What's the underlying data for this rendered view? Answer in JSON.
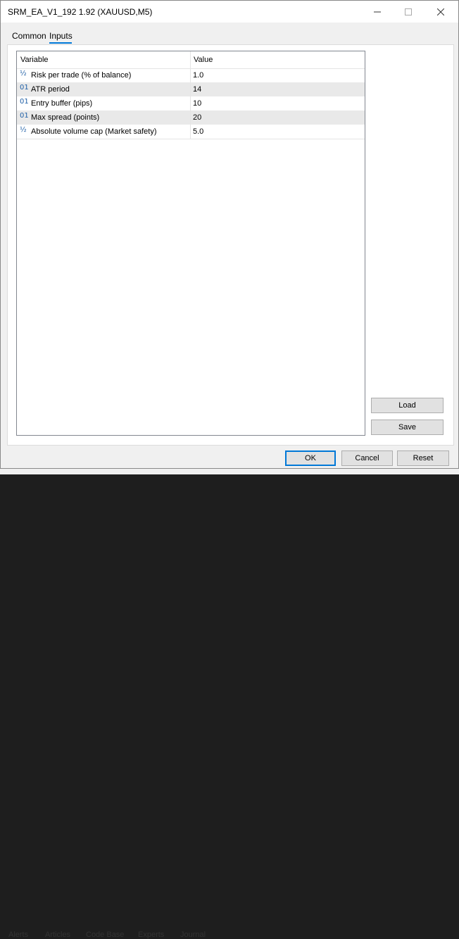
{
  "window": {
    "title": "SRM_EA_V1_192 1.92 (XAUUSD,M5)"
  },
  "tabs": [
    {
      "label": "Common"
    },
    {
      "label": "Inputs"
    }
  ],
  "table": {
    "headers": {
      "variable": "Variable",
      "value": "Value"
    },
    "rows": [
      {
        "icon": "fraction-icon",
        "glyph": "½",
        "name": "Risk per trade (% of balance)",
        "value": "1.0"
      },
      {
        "icon": "integer-icon",
        "glyph": "01",
        "name": "ATR period",
        "value": "14"
      },
      {
        "icon": "integer-icon",
        "glyph": "01",
        "name": "Entry buffer (pips)",
        "value": "10"
      },
      {
        "icon": "integer-icon",
        "glyph": "01",
        "name": "Max spread (points)",
        "value": "20"
      },
      {
        "icon": "fraction-icon",
        "glyph": "½",
        "name": "Absolute volume cap (Market safety)",
        "value": "5.0"
      }
    ]
  },
  "side_buttons": {
    "load": "Load",
    "save": "Save"
  },
  "footer_buttons": {
    "ok": "OK",
    "cancel": "Cancel",
    "reset": "Reset"
  },
  "background_tabs": [
    "Alerts",
    "Articles",
    "Code Base",
    "Experts",
    "Journal"
  ]
}
